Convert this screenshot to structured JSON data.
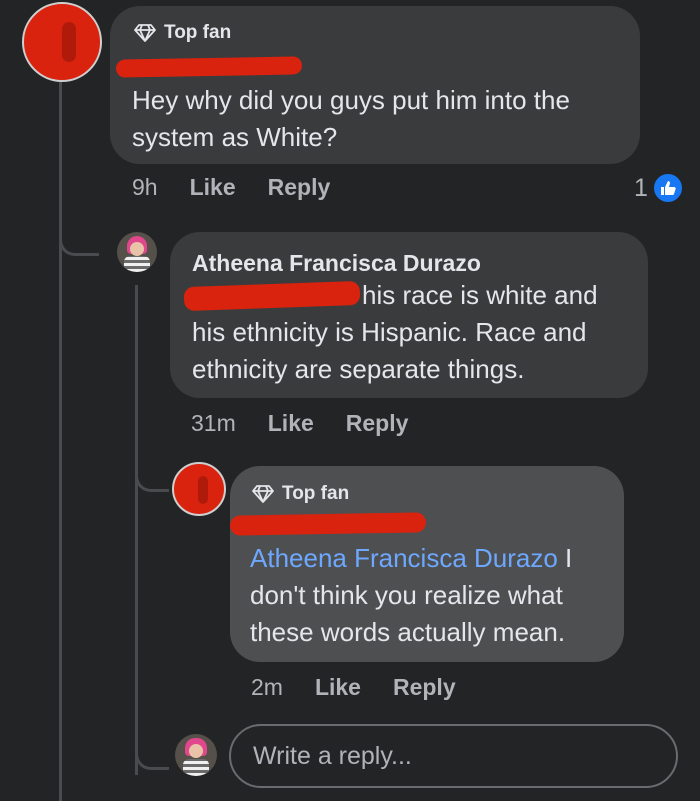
{
  "comment1": {
    "badge": "Top fan",
    "text": "Hey why did you guys put him into the system as White?",
    "time": "9h",
    "like_label": "Like",
    "reply_label": "Reply",
    "reaction_count": "1",
    "reaction_icon": "thumbs-up-icon"
  },
  "comment2": {
    "author": "Atheena Francisca Durazo",
    "text": "his race is white and his ethnicity is Hispanic. Race and ethnicity are separate things.",
    "time": "31m",
    "like_label": "Like",
    "reply_label": "Reply"
  },
  "comment3": {
    "badge": "Top fan",
    "mention": "Atheena Francisca Durazo",
    "text": " I don't think you realize what these words actually mean.",
    "time": "2m",
    "like_label": "Like",
    "reply_label": "Reply"
  },
  "reply_box": {
    "placeholder": "Write a reply..."
  },
  "colors": {
    "background": "#232426",
    "bubble": "#3a3b3c",
    "mention": "#6ea8fe",
    "redaction": "#d9230f",
    "like_blue": "#1877f2"
  }
}
